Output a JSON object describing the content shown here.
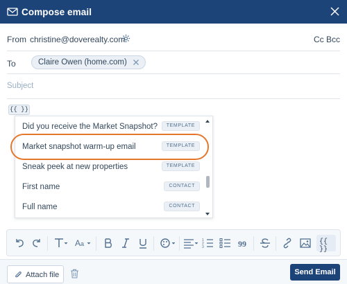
{
  "header": {
    "title": "Compose email",
    "icon": "mail-icon",
    "close_icon": "close-icon",
    "bg": "#1d4478"
  },
  "from": {
    "label": "From",
    "value": "christine@doverealty.com",
    "icon": "gear-icon",
    "cc_bcc": "Cc Bcc"
  },
  "to": {
    "label": "To",
    "recipient": "Claire Owen (home.com)"
  },
  "subject": {
    "placeholder": "Subject",
    "value": ""
  },
  "token_button": {
    "label": "{{  }}"
  },
  "suggestions": [
    {
      "name": "Did you receive the Market Snapshot?",
      "tag": "TEMPLATE"
    },
    {
      "name": "Market snapshot warm-up email",
      "tag": "TEMPLATE",
      "highlighted": true
    },
    {
      "name": "Sneak peek at new properties",
      "tag": "TEMPLATE"
    },
    {
      "name": "First name",
      "tag": "CONTACT"
    },
    {
      "name": "Full name",
      "tag": "CONTACT"
    }
  ],
  "toolbar": {
    "items": [
      "undo-icon",
      "redo-icon",
      "text-style-icon",
      "font-size-icon",
      "bold-icon",
      "italic-icon",
      "underline-icon",
      "color-icon",
      "align-icon",
      "numbered-list-icon",
      "bullet-list-icon",
      "quote-icon",
      "strikethrough-icon",
      "link-icon",
      "image-icon",
      "personalize-token-icon"
    ],
    "token_label": "{{ }}"
  },
  "footer": {
    "attach_label": "Attach file",
    "send_label": "Send Email",
    "trash_icon": "trash-icon"
  },
  "colors": {
    "accent": "#1d4478",
    "highlight_ring": "#e4772c",
    "text": "#33475b",
    "muted": "#99afc4"
  }
}
